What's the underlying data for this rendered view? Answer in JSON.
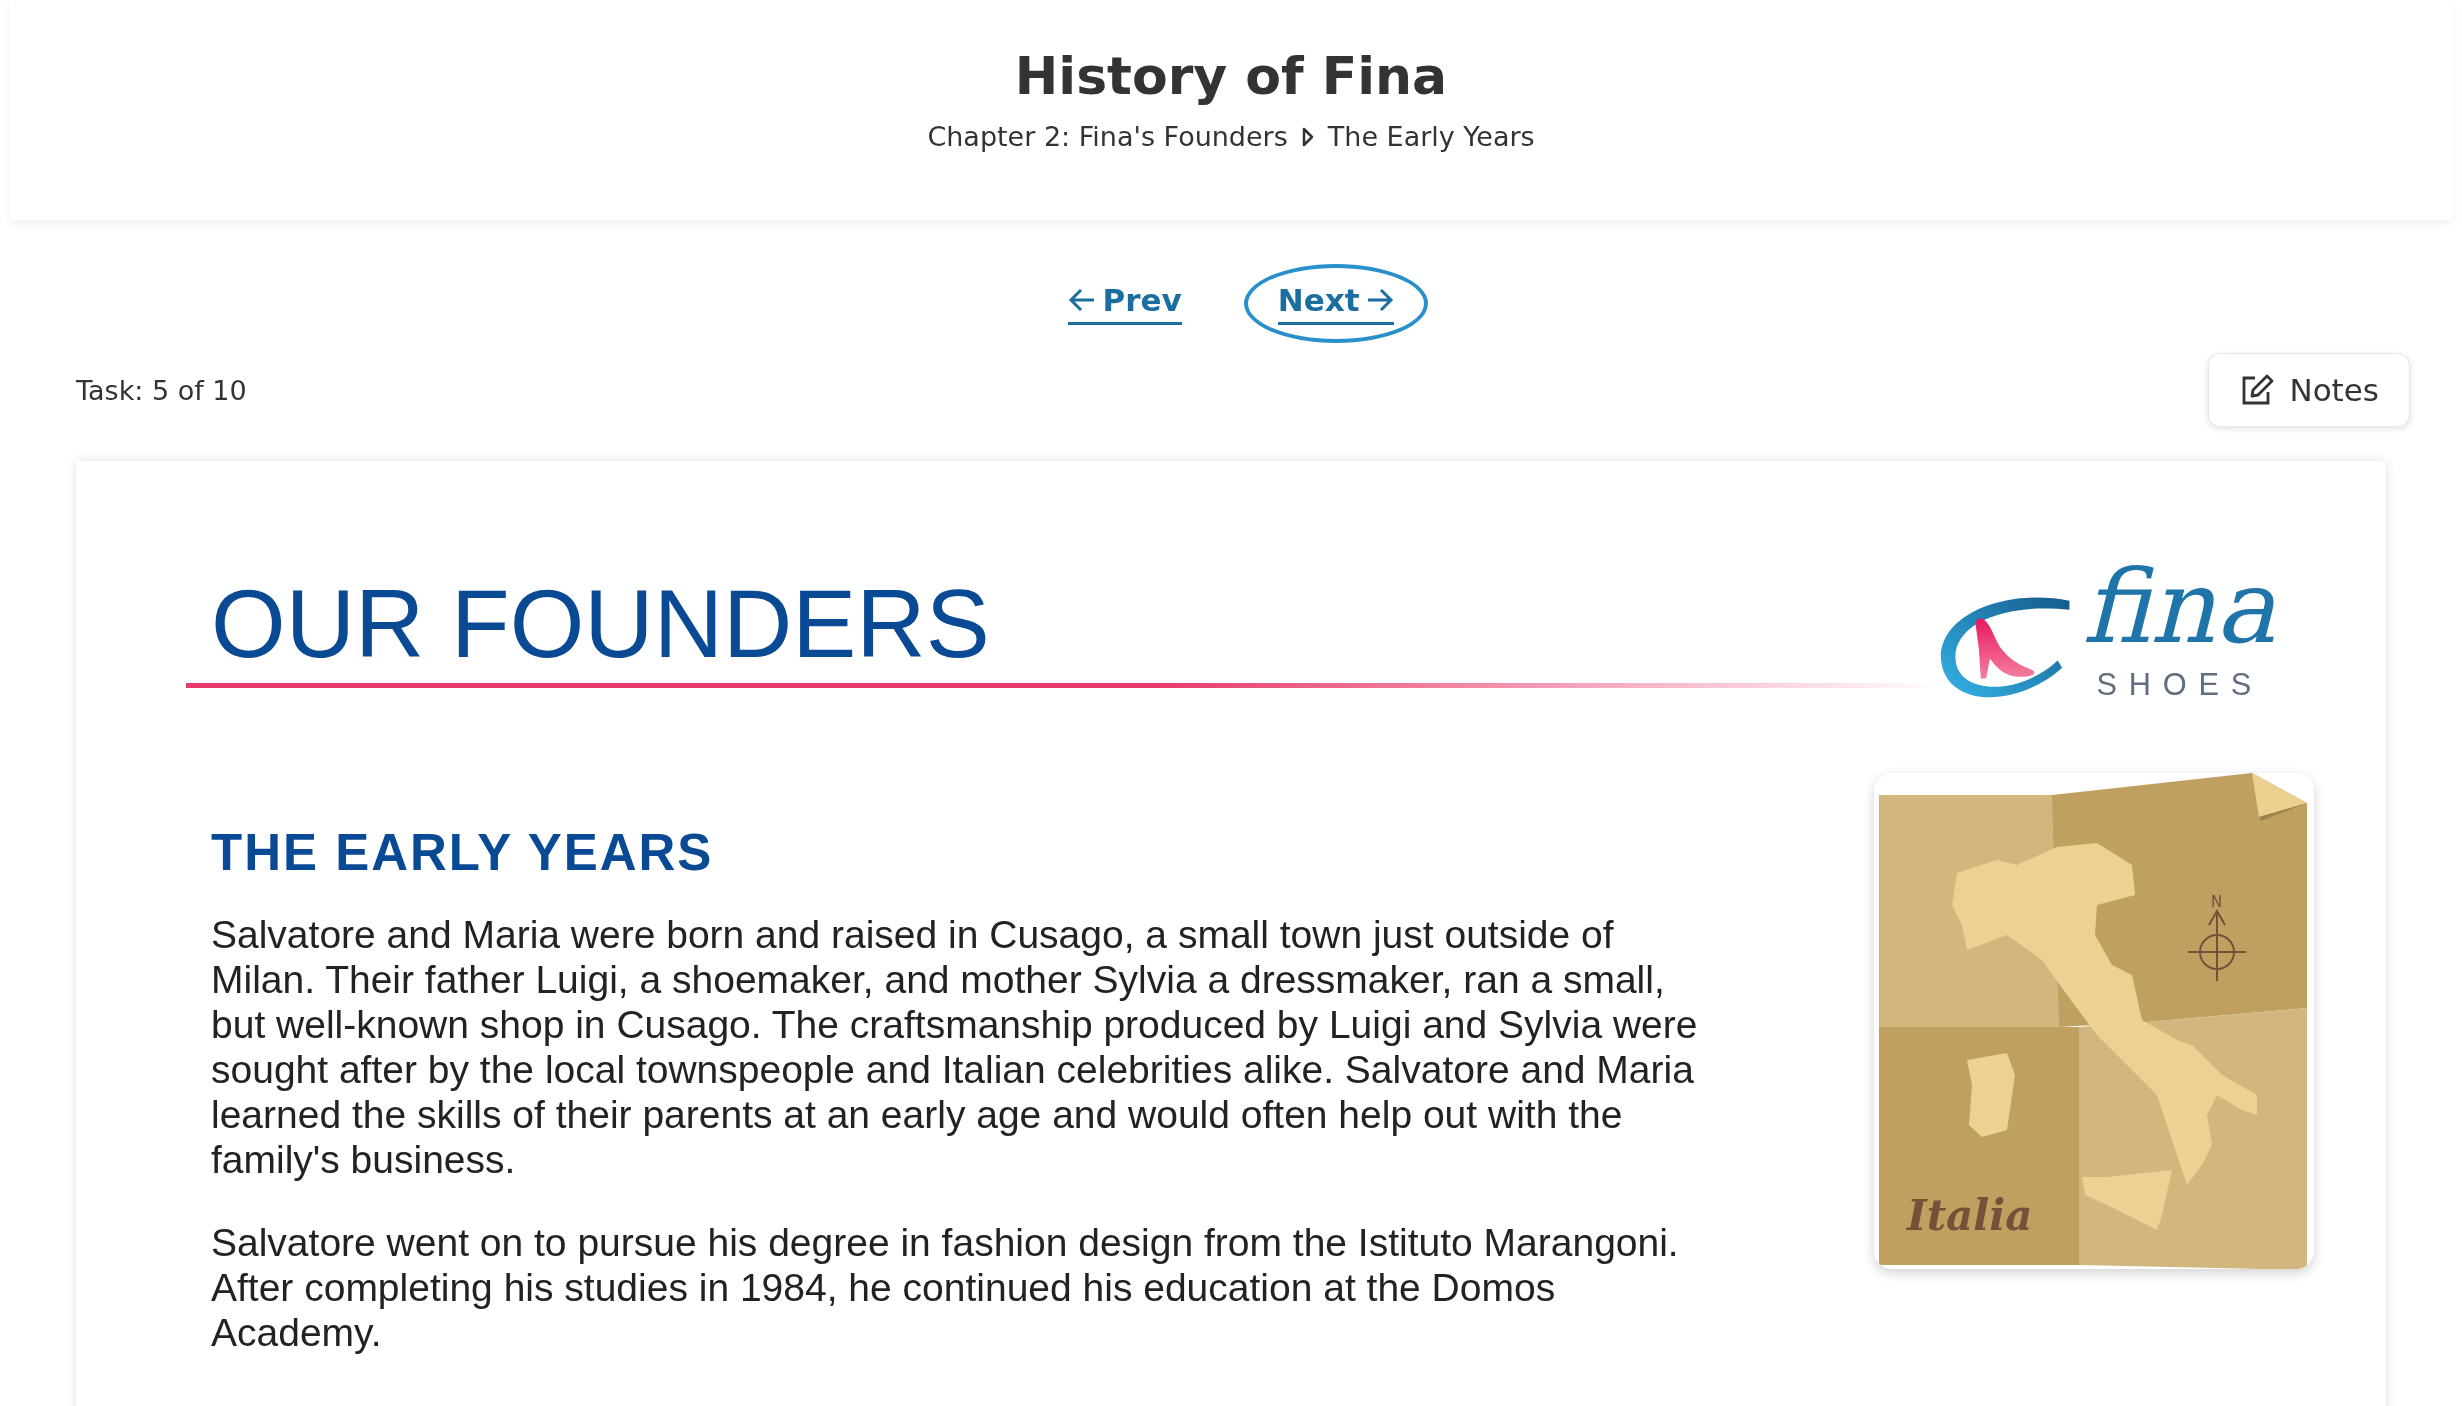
{
  "header": {
    "title": "History of Fina",
    "breadcrumb": [
      {
        "label": "Chapter 2: Fina's Founders"
      },
      {
        "label": "The Early Years"
      }
    ]
  },
  "navigation": [
    {
      "label": "Prev",
      "kind": "back",
      "focused": false
    },
    {
      "label": "Next",
      "kind": "forward",
      "focused": true
    }
  ],
  "task": "Task: 5 of 10",
  "notes_button": "Notes",
  "content": {
    "title": "OUR FOUNDERS",
    "logo": {
      "wordmark": "fina",
      "tagline": "SHOES"
    },
    "section_title": "THE EARLY YEARS",
    "paragraphs": [
      "Salvatore and Maria were born and raised in Cusago, a small town just outside of Milan. Their father Luigi, a shoemaker, and mother Sylvia a dressmaker, ran a small, but well-known shop in Cusago. The craftsmanship produced by Luigi and Sylvia were sought after by the local townspeople and Italian celebrities alike. Salvatore and Maria learned the skills of their parents at an early age and would often help out with the family's business.",
      "Salvatore went on to pursue his degree in fashion design from the Istituto Marangoni. After completing his studies in 1984, he continued his education at the Domos Academy."
    ],
    "map": {
      "label": "Italia",
      "compass": "N"
    }
  }
}
